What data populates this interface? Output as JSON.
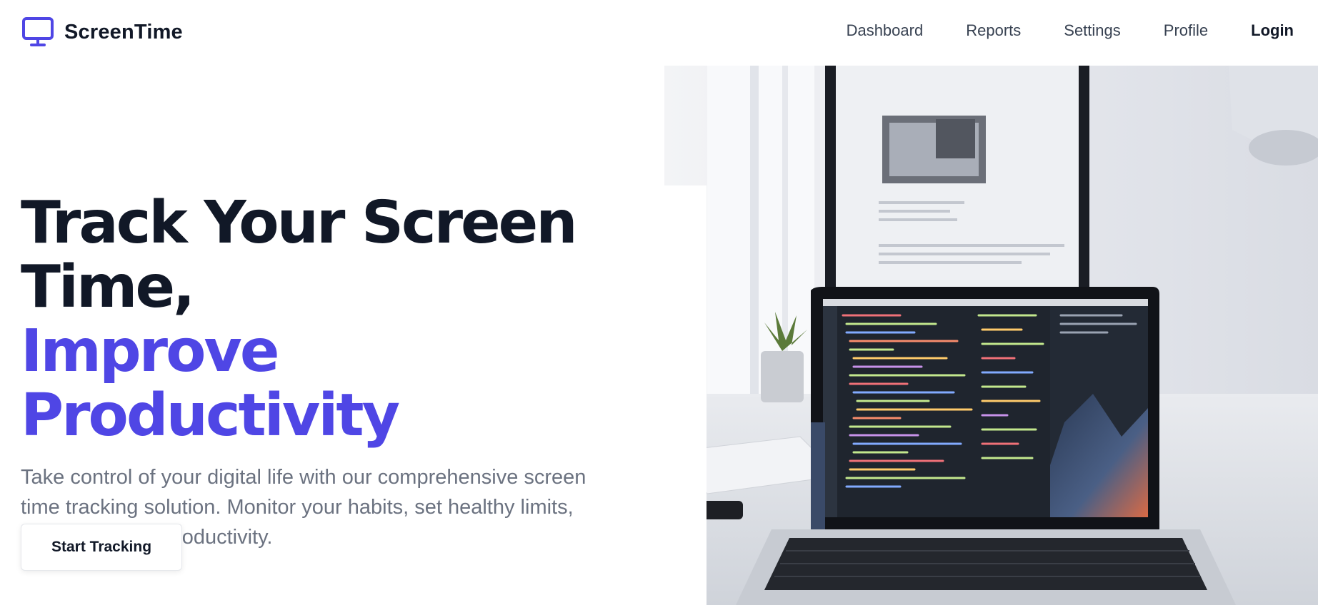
{
  "brand": {
    "name": "ScreenTime",
    "icon": "monitor-icon",
    "accent_color": "#4f46e5"
  },
  "nav": {
    "items": [
      {
        "label": "Dashboard"
      },
      {
        "label": "Reports"
      },
      {
        "label": "Settings"
      },
      {
        "label": "Profile"
      }
    ],
    "login_label": "Login"
  },
  "hero": {
    "headline_line1": "Track Your Screen Time,",
    "headline_line2": "Improve Productivity",
    "subtext": "Take control of your digital life with our comprehensive screen time tracking solution. Monitor your habits, set healthy limits, and boost your productivity.",
    "cta_label": "Start Tracking",
    "image_alt": "laptop-and-monitor-on-desk"
  }
}
